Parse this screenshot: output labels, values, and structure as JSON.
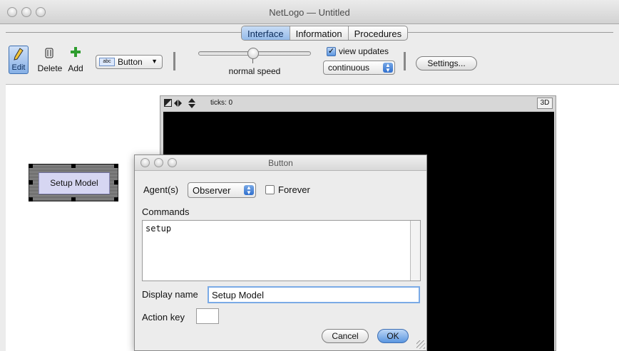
{
  "window": {
    "title": "NetLogo — Untitled"
  },
  "tabs": [
    {
      "label": "Interface",
      "active": true
    },
    {
      "label": "Information",
      "active": false
    },
    {
      "label": "Procedures",
      "active": false
    }
  ],
  "toolbar": {
    "edit_label": "Edit",
    "delete_label": "Delete",
    "add_label": "Add",
    "widget_type": "Button",
    "speed_label": "normal speed",
    "view_updates_label": "view updates",
    "view_updates_checked": true,
    "update_mode": "continuous",
    "settings_label": "Settings..."
  },
  "view": {
    "ticks_label": "ticks: 0",
    "three_d_label": "3D"
  },
  "widget": {
    "button_label": "Setup Model"
  },
  "dialog": {
    "title": "Button",
    "agents_label": "Agent(s)",
    "agents_value": "Observer",
    "forever_label": "Forever",
    "forever_checked": false,
    "commands_label": "Commands",
    "commands_value": "setup",
    "display_name_label": "Display name",
    "display_name_value": "Setup Model",
    "action_key_label": "Action key",
    "action_key_value": "",
    "cancel_label": "Cancel",
    "ok_label": "OK"
  },
  "colors": {
    "accent": "#5b96e0",
    "widget_button_bg": "#d6d6f2",
    "view_background": "#000000"
  }
}
